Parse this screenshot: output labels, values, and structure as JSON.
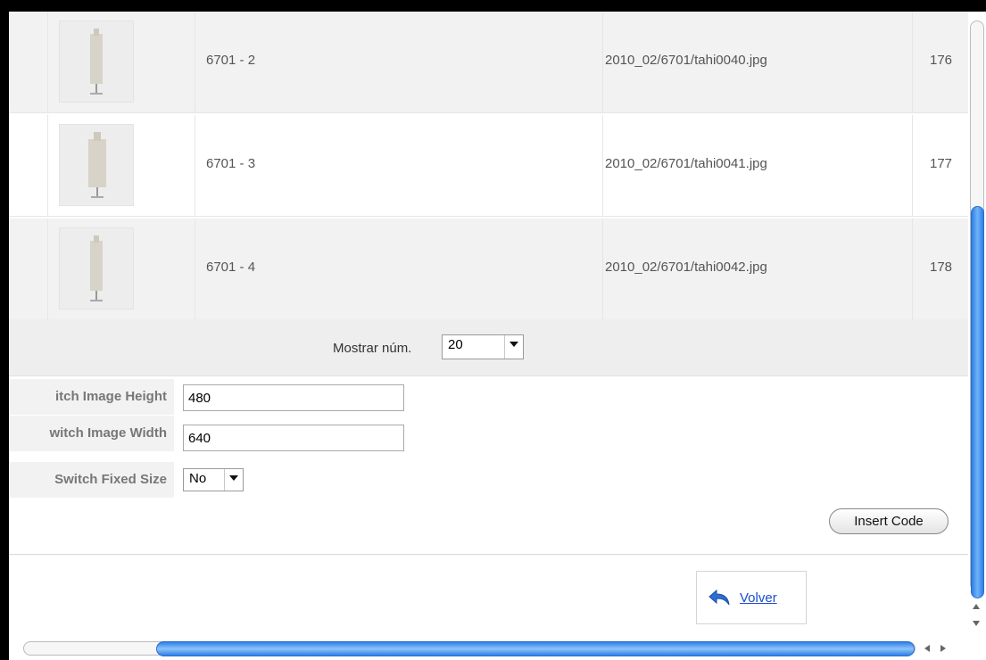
{
  "images_table": {
    "rows": [
      {
        "name": "6701 - 2",
        "file": "2010_02/6701/tahi0040.jpg",
        "id": "176"
      },
      {
        "name": "6701 - 3",
        "file": "2010_02/6701/tahi0041.jpg",
        "id": "177"
      },
      {
        "name": "6701 - 4",
        "file": "2010_02/6701/tahi0042.jpg",
        "id": "178"
      }
    ]
  },
  "pagination": {
    "label": "Mostrar núm.",
    "value": "20"
  },
  "form": {
    "height_label": "itch Image Height",
    "height_value": "480",
    "width_label": "witch Image Width",
    "width_value": "640",
    "fixed_label": "Switch Fixed Size",
    "fixed_value": "No"
  },
  "actions": {
    "insert_code": "Insert Code",
    "volver": "Volver"
  }
}
